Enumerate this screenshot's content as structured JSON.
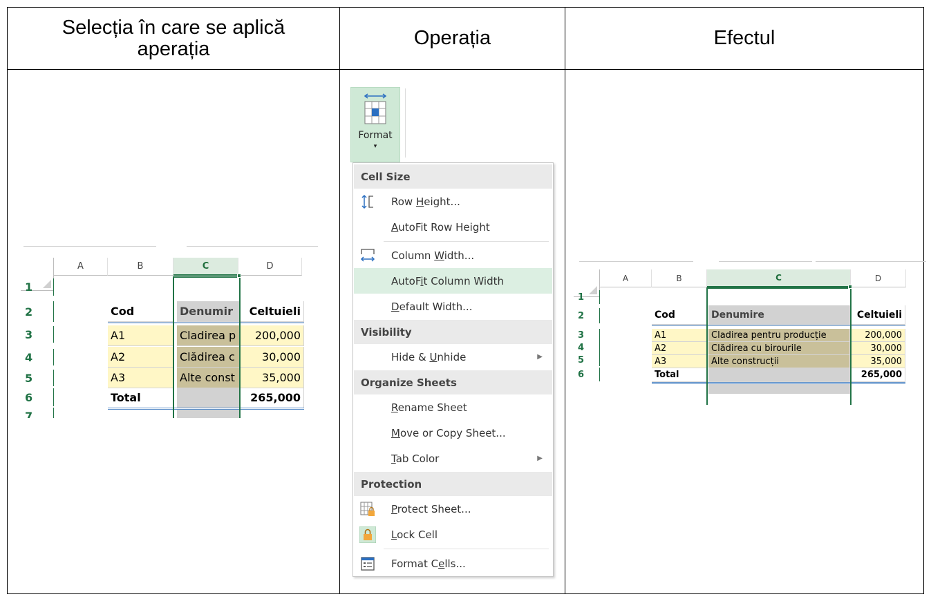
{
  "headers": {
    "selection": "Selecția în care se aplică aperația",
    "operation": "Operația",
    "effect": "Efectul"
  },
  "before_sheet": {
    "columns": [
      "A",
      "B",
      "C",
      "D"
    ],
    "rows": [
      "1",
      "2",
      "3",
      "4",
      "5",
      "6",
      "7"
    ],
    "header_row": {
      "b": "Cod",
      "c": "Denumir",
      "d": "Celtuieli"
    },
    "data": [
      {
        "b": "A1",
        "c": "Cladirea p",
        "d": "200,000"
      },
      {
        "b": "A2",
        "c": "Clădirea c",
        "d": "30,000"
      },
      {
        "b": "A3",
        "c": "Alte const",
        "d": "35,000"
      }
    ],
    "total": {
      "b": "Total",
      "d": "265,000"
    }
  },
  "ribbon": {
    "format_label": "Format",
    "caret": "▾"
  },
  "menu": {
    "sections": [
      "Cell Size",
      "Visibility",
      "Organize Sheets",
      "Protection"
    ],
    "items": {
      "row_height": {
        "pre": "Row ",
        "key": "H",
        "post": "eight..."
      },
      "autofit_row": {
        "pre": "",
        "key": "A",
        "post": "utoFit Row Height"
      },
      "column_width": {
        "pre": "Column ",
        "key": "W",
        "post": "idth..."
      },
      "autofit_col": {
        "pre": "AutoF",
        "key": "i",
        "post": "t Column Width"
      },
      "default_width": {
        "pre": "",
        "key": "D",
        "post": "efault Width..."
      },
      "hide_unhide": {
        "pre": "Hide & ",
        "key": "U",
        "post": "nhide"
      },
      "rename": {
        "pre": "",
        "key": "R",
        "post": "ename Sheet"
      },
      "move_copy": {
        "pre": "",
        "key": "M",
        "post": "ove or Copy Sheet..."
      },
      "tab_color": {
        "pre": "",
        "key": "T",
        "post": "ab Color"
      },
      "protect": {
        "pre": "",
        "key": "P",
        "post": "rotect Sheet..."
      },
      "lock": {
        "pre": "",
        "key": "L",
        "post": "ock Cell"
      },
      "format_cells": {
        "pre": "Format C",
        "key": "e",
        "post": "lls..."
      }
    },
    "submenu_arrow": "▶"
  },
  "after_sheet": {
    "columns": [
      "A",
      "B",
      "C",
      "D"
    ],
    "rows": [
      "1",
      "2",
      "3",
      "4",
      "5",
      "6"
    ],
    "header_row": {
      "b": "Cod",
      "c": "Denumire",
      "d": "Celtuieli"
    },
    "data": [
      {
        "b": "A1",
        "c": "Cladirea pentru producție",
        "d": "200,000"
      },
      {
        "b": "A2",
        "c": "Clădirea cu birourile",
        "d": "30,000"
      },
      {
        "b": "A3",
        "c": "Alte construcții",
        "d": "35,000"
      }
    ],
    "total": {
      "b": "Total",
      "d": "265,000"
    }
  }
}
